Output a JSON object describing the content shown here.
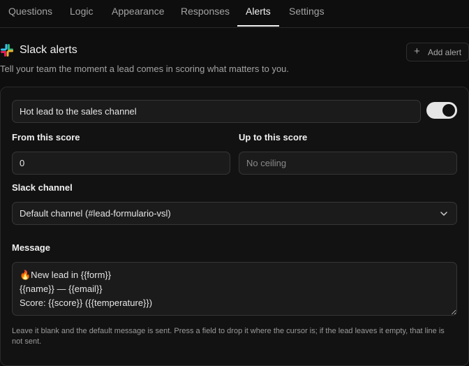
{
  "tabs": [
    {
      "label": "Questions"
    },
    {
      "label": "Logic"
    },
    {
      "label": "Appearance"
    },
    {
      "label": "Responses"
    },
    {
      "label": "Alerts",
      "active": true
    },
    {
      "label": "Settings"
    }
  ],
  "section": {
    "icon": "slack-icon",
    "title": "Slack alerts",
    "description": "Tell your team the moment a lead comes in scoring what matters to you.",
    "add_button": {
      "icon": "plus-icon",
      "label": "Add alert"
    }
  },
  "alert": {
    "name": "Hot lead to the sales channel",
    "enabled": true,
    "from_score": {
      "label": "From this score",
      "value": "0"
    },
    "up_to_score": {
      "label": "Up to this score",
      "placeholder": "No ceiling",
      "value": ""
    },
    "channel": {
      "label": "Slack channel",
      "selected": "Default channel (#lead-formulario-vsl)",
      "icon": "chevron-down-icon"
    },
    "message": {
      "label": "Message",
      "value": "🔥New lead in {{form}}\n{{name}} — {{email}}\nScore: {{score}} ({{temperature}})"
    },
    "help_text": "Leave it blank and the default message is sent. Press a field to drop it where the cursor is; if the lead leaves it empty, that line is not sent."
  },
  "colors": {
    "background": "#0e0e0e",
    "card": "#121212",
    "field": "#1b1b1b",
    "toggle_on": "#e5e5e5",
    "slack_blue": "#36C5F0",
    "slack_green": "#2EB67D",
    "slack_yellow": "#ECB22E",
    "slack_red": "#E01E5A"
  }
}
